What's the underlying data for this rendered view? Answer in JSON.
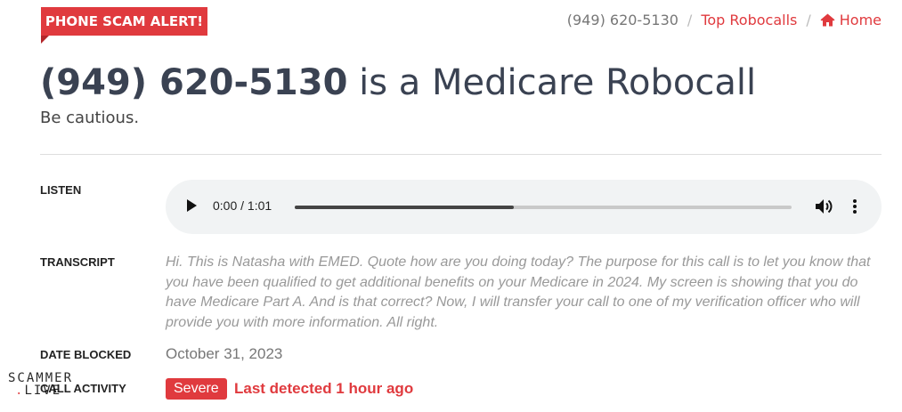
{
  "badge": {
    "label": "PHONE SCAM ALERT!",
    "color": "#e03a3e"
  },
  "nav": {
    "phone": "(949) 620-5130",
    "separator": "/",
    "top_robocalls": "Top Robocalls",
    "home": "Home",
    "home_icon": "home-icon"
  },
  "header": {
    "number": "(949) 620-5130",
    "title_suffix": "is a Medicare Robocall",
    "subtitle": "Be cautious."
  },
  "listen": {
    "label": "LISTEN",
    "player": {
      "time": "0:00 / 1:01",
      "progress_fraction": 0.44,
      "icons": [
        "play-icon",
        "volume-icon",
        "more-vertical-icon"
      ]
    }
  },
  "transcript": {
    "label": "TRANSCRIPT",
    "text": "Hi. This is Natasha with EMED. Quote how are you doing today? The purpose for this call is to let you know that you have been qualified to get additional benefits on your Medicare in 2024. My screen is showing that you do have Medicare Part A. And is that correct? Now, I will transfer your call to one of my verification officer who will provide you with more information. All right."
  },
  "date_blocked": {
    "label": "DATE BLOCKED",
    "value": "October 31, 2023"
  },
  "call_activity": {
    "label": "CALL ACTIVITY",
    "severity": "Severe",
    "last_detected": "Last detected 1 hour ago"
  },
  "watermark": {
    "line1": "SCAMMER",
    "dot": ".",
    "line2": "LIVE"
  }
}
